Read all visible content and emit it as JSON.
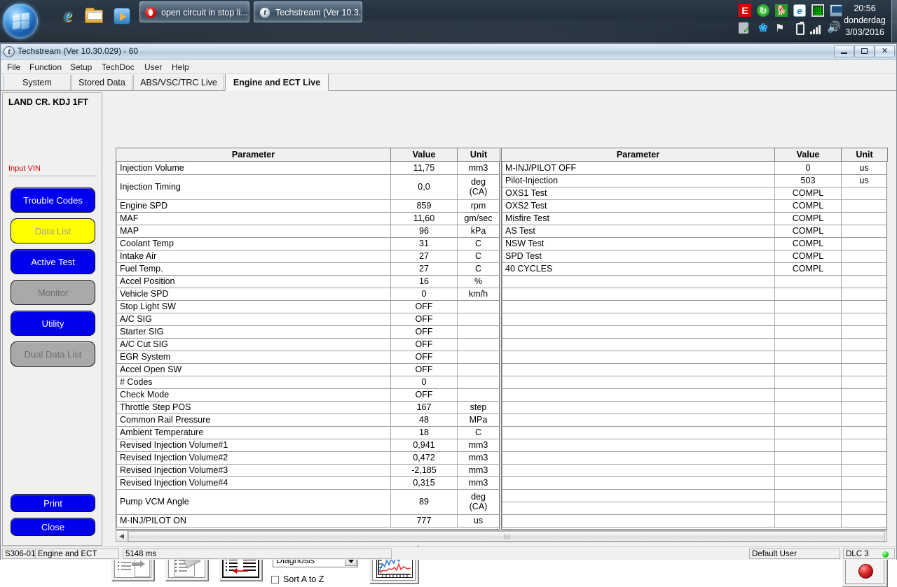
{
  "taskbar": {
    "start_label": "Start",
    "quick_launch": [
      "internet-explorer-icon",
      "windows-explorer-icon",
      "media-player-icon"
    ],
    "buttons": [
      {
        "label": "open circuit in stop li...",
        "icon": "opera-icon"
      },
      {
        "label": "Techstream (Ver 10.3...",
        "icon": "techstream-icon"
      }
    ],
    "tray_icons": [
      "eset-icon",
      "update-icon",
      "dog-icon",
      "internet-explorer-warning-icon",
      "green-grid-icon",
      "remote-display-icon",
      "usb-safely-remove-icon",
      "bluetooth-icon",
      "network-warning-icon",
      "battery-icon",
      "signal-bars-icon",
      "volume-icon"
    ],
    "clock": {
      "time": "20:56",
      "day": "donderdag",
      "date": "3/03/2016"
    }
  },
  "window": {
    "title": "Techstream (Ver 10.30.029) - 60",
    "icon": "techstream-icon",
    "controls": {
      "minimize": "–",
      "restore": "❐",
      "close": "✕"
    }
  },
  "menubar": {
    "items": [
      "File",
      "Function",
      "Setup",
      "TechDoc",
      "User",
      "Help"
    ]
  },
  "tabs": [
    {
      "label": "System Select",
      "active": false
    },
    {
      "label": "Stored Data",
      "active": false
    },
    {
      "label": "ABS/VSC/TRC Live",
      "active": false
    },
    {
      "label": "Engine and ECT Live",
      "active": true
    }
  ],
  "sidebar": {
    "vehicle": "LAND CR. KDJ 1FT",
    "input_vin": "Input VIN",
    "buttons": [
      {
        "label": "Trouble Codes",
        "state": "enabled"
      },
      {
        "label": "Data List",
        "state": "selected"
      },
      {
        "label": "Active Test",
        "state": "enabled"
      },
      {
        "label": "Monitor",
        "state": "disabled"
      },
      {
        "label": "Utility",
        "state": "enabled"
      },
      {
        "label": "Dual Data List",
        "state": "disabled"
      }
    ],
    "bottom_buttons": [
      {
        "label": "Print"
      },
      {
        "label": "Close"
      }
    ]
  },
  "tables": {
    "headers": {
      "parameter": "Parameter",
      "value": "Value",
      "unit": "Unit"
    },
    "left_rows": [
      {
        "parameter": "Injection Volume",
        "value": "11,75",
        "unit": "mm3",
        "tall": false
      },
      {
        "parameter": "Injection Timing",
        "value": "0,0",
        "unit": "deg\n(CA)",
        "tall": true
      },
      {
        "parameter": "Engine SPD",
        "value": "859",
        "unit": "rpm",
        "tall": false
      },
      {
        "parameter": "MAF",
        "value": "11,60",
        "unit": "gm/sec",
        "tall": false
      },
      {
        "parameter": "MAP",
        "value": "96",
        "unit": "kPa",
        "tall": false
      },
      {
        "parameter": "Coolant Temp",
        "value": "31",
        "unit": "C",
        "tall": false
      },
      {
        "parameter": "Intake Air",
        "value": "27",
        "unit": "C",
        "tall": false
      },
      {
        "parameter": "Fuel Temp.",
        "value": "27",
        "unit": "C",
        "tall": false
      },
      {
        "parameter": "Accel Position",
        "value": "16",
        "unit": "%",
        "tall": false
      },
      {
        "parameter": "Vehicle SPD",
        "value": "0",
        "unit": "km/h",
        "tall": false
      },
      {
        "parameter": "Stop Light SW",
        "value": "OFF",
        "unit": "",
        "tall": false
      },
      {
        "parameter": "A/C SIG",
        "value": "OFF",
        "unit": "",
        "tall": false
      },
      {
        "parameter": "Starter SIG",
        "value": "OFF",
        "unit": "",
        "tall": false
      },
      {
        "parameter": "A/C Cut SIG",
        "value": "OFF",
        "unit": "",
        "tall": false
      },
      {
        "parameter": "EGR System",
        "value": "OFF",
        "unit": "",
        "tall": false
      },
      {
        "parameter": "Accel Open SW",
        "value": "OFF",
        "unit": "",
        "tall": false
      },
      {
        "parameter": "# Codes",
        "value": "0",
        "unit": "",
        "tall": false
      },
      {
        "parameter": "Check Mode",
        "value": "OFF",
        "unit": "",
        "tall": false
      },
      {
        "parameter": "Throttle Step POS",
        "value": "167",
        "unit": "step",
        "tall": false
      },
      {
        "parameter": "Common Rail Pressure",
        "value": "48",
        "unit": "MPa",
        "tall": false
      },
      {
        "parameter": "Ambient Temperature",
        "value": "18",
        "unit": "C",
        "tall": false
      },
      {
        "parameter": "Revised Injection Volume#1",
        "value": "0,941",
        "unit": "mm3",
        "tall": false
      },
      {
        "parameter": "Revised Injection Volume#2",
        "value": "0,472",
        "unit": "mm3",
        "tall": false
      },
      {
        "parameter": "Revised Injection Volume#3",
        "value": "-2,185",
        "unit": "mm3",
        "tall": false
      },
      {
        "parameter": "Revised Injection Volume#4",
        "value": "0,315",
        "unit": "mm3",
        "tall": false
      },
      {
        "parameter": "Pump VCM Angle",
        "value": "89",
        "unit": "deg\n(CA)",
        "tall": true
      },
      {
        "parameter": "M-INJ/PILOT ON",
        "value": "777",
        "unit": "us",
        "tall": false
      }
    ],
    "right_rows": [
      {
        "parameter": "M-INJ/PILOT OFF",
        "value": "0",
        "unit": "us",
        "tall": false
      },
      {
        "parameter": "Pilot-Injection",
        "value": "503",
        "unit": "us",
        "tall": false
      },
      {
        "parameter": "OXS1 Test",
        "value": "COMPL",
        "unit": "",
        "tall": false
      },
      {
        "parameter": "OXS2 Test",
        "value": "COMPL",
        "unit": "",
        "tall": false
      },
      {
        "parameter": "Misfire Test",
        "value": "COMPL",
        "unit": "",
        "tall": false
      },
      {
        "parameter": "AS Test",
        "value": "COMPL",
        "unit": "",
        "tall": false
      },
      {
        "parameter": "NSW Test",
        "value": "COMPL",
        "unit": "",
        "tall": false
      },
      {
        "parameter": "SPD Test",
        "value": "COMPL",
        "unit": "",
        "tall": false
      },
      {
        "parameter": "40 CYCLES",
        "value": "COMPL",
        "unit": "",
        "tall": false
      },
      {
        "parameter": "",
        "value": "",
        "unit": "",
        "tall": false
      },
      {
        "parameter": "",
        "value": "",
        "unit": "",
        "tall": false
      },
      {
        "parameter": "",
        "value": "",
        "unit": "",
        "tall": false
      },
      {
        "parameter": "",
        "value": "",
        "unit": "",
        "tall": false
      },
      {
        "parameter": "",
        "value": "",
        "unit": "",
        "tall": false
      },
      {
        "parameter": "",
        "value": "",
        "unit": "",
        "tall": false
      },
      {
        "parameter": "",
        "value": "",
        "unit": "",
        "tall": false
      },
      {
        "parameter": "",
        "value": "",
        "unit": "",
        "tall": false
      },
      {
        "parameter": "",
        "value": "",
        "unit": "",
        "tall": false
      },
      {
        "parameter": "",
        "value": "",
        "unit": "",
        "tall": false
      },
      {
        "parameter": "",
        "value": "",
        "unit": "",
        "tall": false
      },
      {
        "parameter": "",
        "value": "",
        "unit": "",
        "tall": false
      },
      {
        "parameter": "",
        "value": "",
        "unit": "",
        "tall": false
      },
      {
        "parameter": "",
        "value": "",
        "unit": "",
        "tall": false
      },
      {
        "parameter": "",
        "value": "",
        "unit": "",
        "tall": false
      },
      {
        "parameter": "",
        "value": "",
        "unit": "",
        "tall": false
      },
      {
        "parameter": "",
        "value": "",
        "unit": "",
        "tall": false
      },
      {
        "parameter": "",
        "value": "",
        "unit": "",
        "tall": false
      },
      {
        "parameter": "",
        "value": "",
        "unit": "",
        "tall": false
      },
      {
        "parameter": "",
        "value": "",
        "unit": "",
        "tall": false
      }
    ]
  },
  "toolbar": {
    "buttons": [
      {
        "name": "select-data-button",
        "icon": "list-arrow-icon"
      },
      {
        "name": "clear-data-button",
        "icon": "list-eraser-icon"
      },
      {
        "name": "swap-data-button",
        "icon": "list-swap-icon"
      },
      {
        "name": "graph-button",
        "icon": "line-chart-icon"
      }
    ],
    "combo_value": "Diagnosis",
    "sort_label": "Sort A to Z",
    "sort_checked": false,
    "record_button": "record-icon"
  },
  "statusbar": {
    "code": "S306-01",
    "system": "Engine and ECT",
    "timing": "5148 ms",
    "user": "Default User",
    "connector": "DLC 3",
    "connector_state_color": "#18cc18"
  }
}
